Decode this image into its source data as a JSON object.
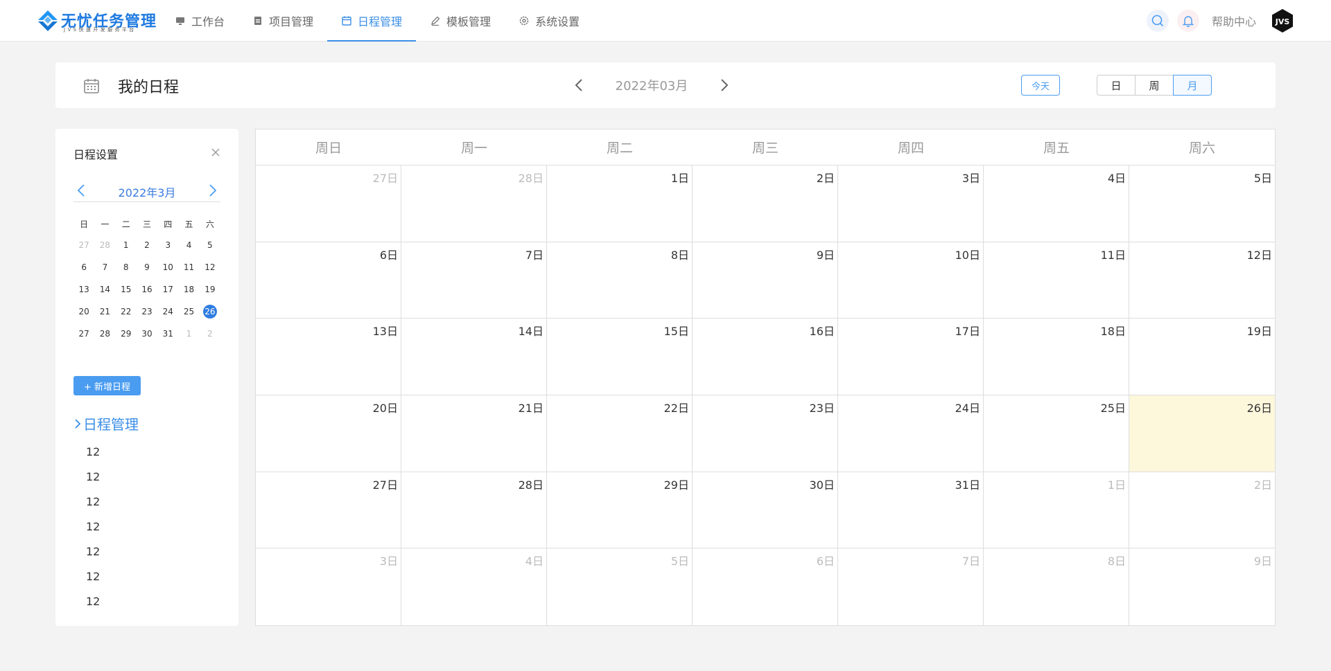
{
  "logo": {
    "title": "无忧任务管理",
    "subtitle": "JVS快速开发服务平台"
  },
  "nav": {
    "items": [
      {
        "label": "工作台",
        "icon": "monitor-icon"
      },
      {
        "label": "项目管理",
        "icon": "clipboard-icon"
      },
      {
        "label": "日程管理",
        "icon": "calendar-icon"
      },
      {
        "label": "模板管理",
        "icon": "pen-icon"
      },
      {
        "label": "系统设置",
        "icon": "gear-icon"
      }
    ],
    "active": "日程管理"
  },
  "topbar": {
    "help_label": "帮助中心",
    "avatar_text": "JVS"
  },
  "header": {
    "title": "我的日程",
    "month_label": "2022年03月",
    "today_label": "今天",
    "views": [
      "日",
      "周",
      "月"
    ],
    "active_view": "月"
  },
  "sidebar": {
    "title": "日程设置",
    "mini_month": "2022年3月",
    "weekdays": [
      "日",
      "一",
      "二",
      "三",
      "四",
      "五",
      "六"
    ],
    "days": [
      {
        "d": "27",
        "other": true
      },
      {
        "d": "28",
        "other": true
      },
      {
        "d": "1"
      },
      {
        "d": "2"
      },
      {
        "d": "3"
      },
      {
        "d": "4"
      },
      {
        "d": "5"
      },
      {
        "d": "6"
      },
      {
        "d": "7"
      },
      {
        "d": "8"
      },
      {
        "d": "9"
      },
      {
        "d": "10"
      },
      {
        "d": "11"
      },
      {
        "d": "12"
      },
      {
        "d": "13"
      },
      {
        "d": "14"
      },
      {
        "d": "15"
      },
      {
        "d": "16"
      },
      {
        "d": "17"
      },
      {
        "d": "18"
      },
      {
        "d": "19"
      },
      {
        "d": "20"
      },
      {
        "d": "21"
      },
      {
        "d": "22"
      },
      {
        "d": "23"
      },
      {
        "d": "24"
      },
      {
        "d": "25"
      },
      {
        "d": "26",
        "today": true
      },
      {
        "d": "27"
      },
      {
        "d": "28"
      },
      {
        "d": "29"
      },
      {
        "d": "30"
      },
      {
        "d": "31"
      },
      {
        "d": "1",
        "other": true
      },
      {
        "d": "2",
        "other": true
      }
    ],
    "add_label": "+ 新增日程",
    "tree_title": "日程管理",
    "tree_items": [
      "12",
      "12",
      "12",
      "12",
      "12",
      "12",
      "12"
    ]
  },
  "calendar": {
    "weekdays": [
      "周日",
      "周一",
      "周二",
      "周三",
      "周四",
      "周五",
      "周六"
    ],
    "cells": [
      {
        "label": "27日",
        "other": true
      },
      {
        "label": "28日",
        "other": true
      },
      {
        "label": "1日"
      },
      {
        "label": "2日"
      },
      {
        "label": "3日"
      },
      {
        "label": "4日"
      },
      {
        "label": "5日"
      },
      {
        "label": "6日"
      },
      {
        "label": "7日"
      },
      {
        "label": "8日"
      },
      {
        "label": "9日"
      },
      {
        "label": "10日"
      },
      {
        "label": "11日"
      },
      {
        "label": "12日"
      },
      {
        "label": "13日"
      },
      {
        "label": "14日"
      },
      {
        "label": "15日"
      },
      {
        "label": "16日"
      },
      {
        "label": "17日"
      },
      {
        "label": "18日"
      },
      {
        "label": "19日"
      },
      {
        "label": "20日"
      },
      {
        "label": "21日"
      },
      {
        "label": "22日"
      },
      {
        "label": "23日"
      },
      {
        "label": "24日"
      },
      {
        "label": "25日"
      },
      {
        "label": "26日",
        "today": true
      },
      {
        "label": "27日"
      },
      {
        "label": "28日"
      },
      {
        "label": "29日"
      },
      {
        "label": "30日"
      },
      {
        "label": "31日"
      },
      {
        "label": "1日",
        "other": true
      },
      {
        "label": "2日",
        "other": true
      },
      {
        "label": "3日",
        "other": true
      },
      {
        "label": "4日",
        "other": true
      },
      {
        "label": "5日",
        "other": true
      },
      {
        "label": "6日",
        "other": true
      },
      {
        "label": "7日",
        "other": true
      },
      {
        "label": "8日",
        "other": true
      },
      {
        "label": "9日",
        "other": true
      }
    ]
  },
  "colors": {
    "accent": "#3a8ee6",
    "today_cell": "#fdf7dc",
    "today_dot": "#2f7de1"
  }
}
